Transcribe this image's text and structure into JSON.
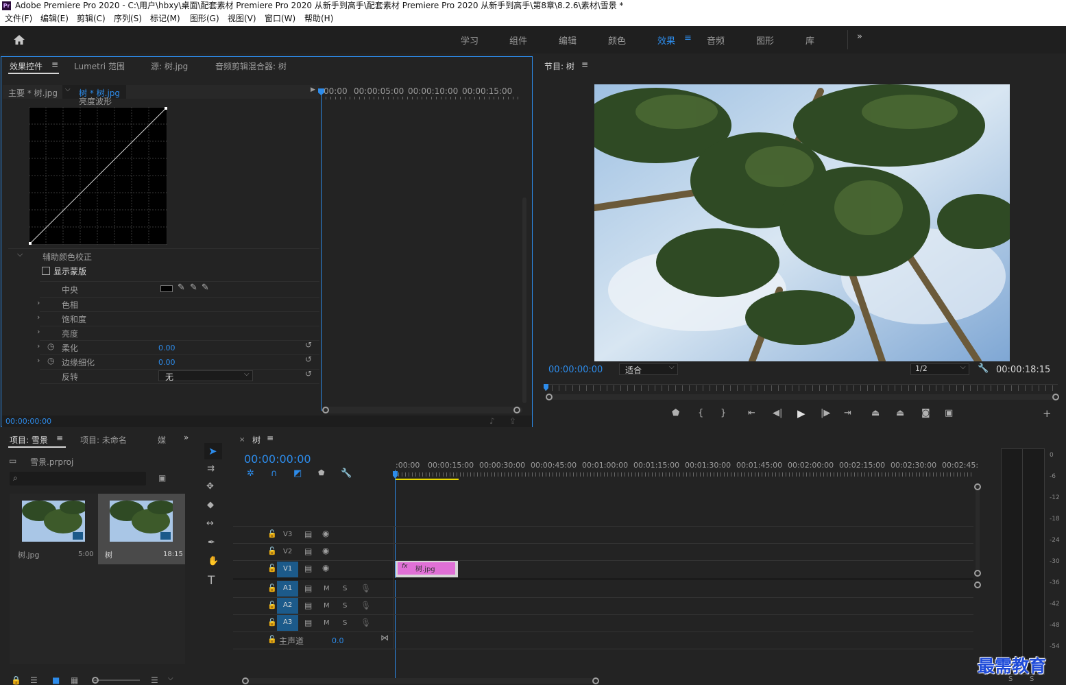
{
  "app": {
    "logo": "Pr",
    "title": "Adobe Premiere Pro 2020 - C:\\用户\\hbxy\\桌面\\配套素材 Premiere Pro 2020 从新手到高手\\配套素材 Premiere Pro 2020 从新手到高手\\第8章\\8.2.6\\素材\\雪景 *"
  },
  "menu": [
    "文件(F)",
    "编辑(E)",
    "剪辑(C)",
    "序列(S)",
    "标记(M)",
    "图形(G)",
    "视图(V)",
    "窗口(W)",
    "帮助(H)"
  ],
  "workspaces": [
    "学习",
    "组件",
    "编辑",
    "颜色",
    "效果",
    "音频",
    "图形",
    "库"
  ],
  "workspace_active": "效果",
  "effects_panel": {
    "tabs": [
      "效果控件",
      "Lumetri 范围",
      "源: 树.jpg",
      "音频剪辑混合器: 树"
    ],
    "master": "主要 * 树.jpg",
    "clip": "树 * 树.jpg",
    "ruler": [
      "00:00",
      "00:00:05:00",
      "00:00:10:00",
      "00:00:15:00"
    ],
    "curve_label": "亮度波形",
    "section": "辅助颜色校正",
    "show_mask": "显示蒙版",
    "props": {
      "center": "中央",
      "hue": "色相",
      "saturation": "饱和度",
      "luma": "亮度",
      "soften": "柔化",
      "soften_val": "0.00",
      "edge": "边缘细化",
      "edge_val": "0.00",
      "invert": "反转",
      "invert_val": "无"
    },
    "timecode": "00:00:00:00"
  },
  "program": {
    "title": "节目: 树",
    "timecode": "00:00:00:00",
    "fit": "适合",
    "resolution": "1/2",
    "duration": "00:00:18:15"
  },
  "project": {
    "tabs": [
      "项目: 雪景",
      "项目: 未命名",
      "媒"
    ],
    "file": "雪景.prproj",
    "items": [
      {
        "name": "树.jpg",
        "dur": "5:00"
      },
      {
        "name": "树",
        "dur": "18:15"
      }
    ]
  },
  "timeline": {
    "tab": "树",
    "timecode": "00:00:00:00",
    "ruler": [
      ":00:00",
      "00:00:15:00",
      "00:00:30:00",
      "00:00:45:00",
      "00:01:00:00",
      "00:01:15:00",
      "00:01:30:00",
      "00:01:45:00",
      "00:02:00:00",
      "00:02:15:00",
      "00:02:30:00",
      "00:02:45:"
    ],
    "video_tracks": [
      "V3",
      "V2",
      "V1"
    ],
    "audio_tracks": [
      "A1",
      "A2",
      "A3"
    ],
    "mute": "M",
    "solo": "S",
    "master": "主声道",
    "master_val": "0.0",
    "clip": {
      "fx": "fx",
      "name": "树.jpg",
      "color": "#e070d6"
    }
  },
  "meter": {
    "scale": [
      "0",
      "-6",
      "-12",
      "-18",
      "-24",
      "-30",
      "-36",
      "-42",
      "-48",
      "-54"
    ],
    "solo": "S"
  },
  "watermark": "最需教育"
}
